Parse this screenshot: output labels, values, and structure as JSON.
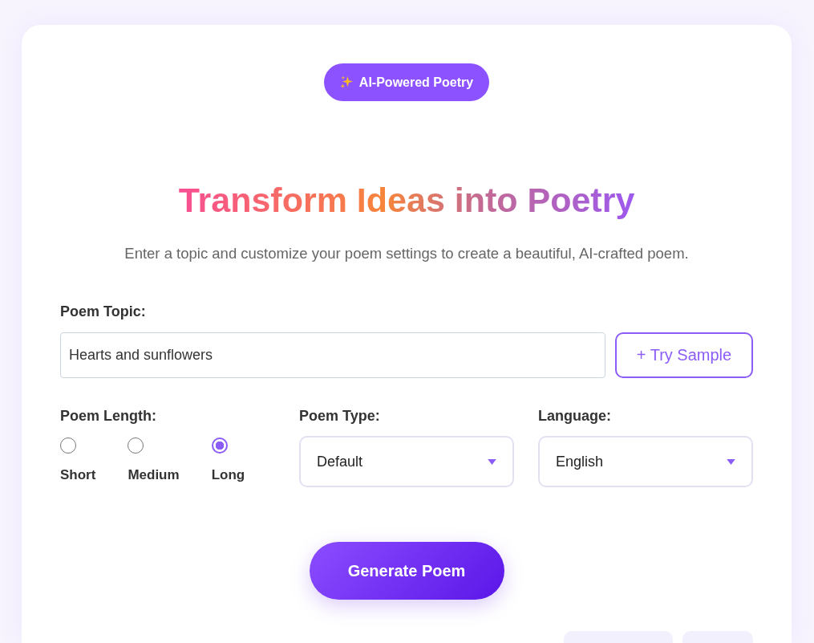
{
  "badge": {
    "label": "AI-Powered Poetry"
  },
  "heading": {
    "title": "Transform Ideas into Poetry",
    "subtitle": "Enter a topic and customize your poem settings to create a beautiful, AI-crafted poem."
  },
  "topic": {
    "label": "Poem Topic:",
    "value": "Hearts and sunflowers"
  },
  "sample_button": {
    "label": "+ Try Sample"
  },
  "length": {
    "label": "Poem Length:",
    "options": [
      {
        "label": "Short",
        "selected": false
      },
      {
        "label": "Medium",
        "selected": false
      },
      {
        "label": "Long",
        "selected": true
      }
    ]
  },
  "poem_type": {
    "label": "Poem Type:",
    "value": "Default"
  },
  "language": {
    "label": "Language:",
    "value": "English"
  },
  "generate_button": {
    "label": "Generate Poem"
  }
}
